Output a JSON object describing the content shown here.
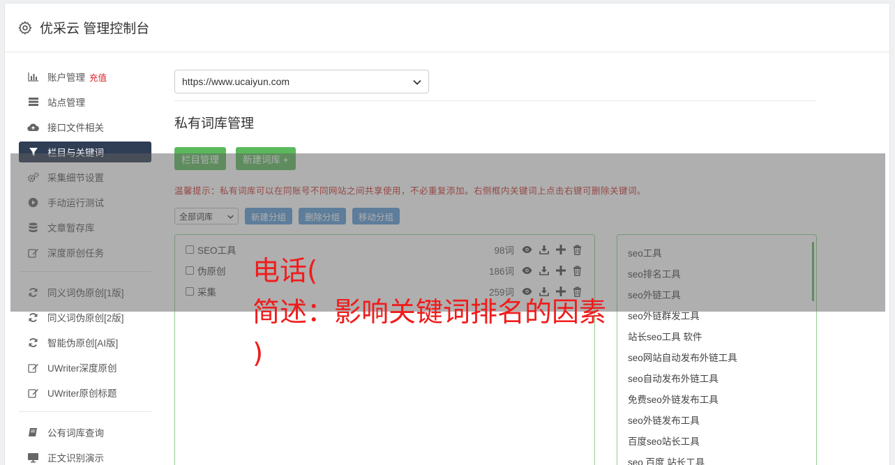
{
  "header": {
    "title": "优采云 管理控制台",
    "icon": "gear-icon"
  },
  "sidebar": {
    "group1": [
      {
        "label": "账户管理",
        "badge": "充值",
        "icon": "bar-chart-icon"
      },
      {
        "label": "站点管理",
        "icon": "server-icon"
      },
      {
        "label": "接口文件相关",
        "icon": "cloud-upload-icon"
      },
      {
        "label": "栏目与关键词",
        "icon": "filter-icon",
        "active": true
      },
      {
        "label": "采集细节设置",
        "icon": "cogs-icon"
      },
      {
        "label": "手动运行测试",
        "icon": "play-circle-icon"
      },
      {
        "label": "文章暂存库",
        "icon": "database-icon"
      },
      {
        "label": "深度原创任务",
        "icon": "edit-icon"
      }
    ],
    "group2": [
      {
        "label": "同义词伪原创[1版]",
        "icon": "refresh-icon"
      },
      {
        "label": "同义词伪原创[2版]",
        "icon": "refresh-icon"
      },
      {
        "label": "智能伪原创[AI版]",
        "icon": "refresh-icon"
      },
      {
        "label": "UWriter深度原创",
        "icon": "edit-icon"
      },
      {
        "label": "UWriter原创标题",
        "icon": "edit-icon"
      }
    ],
    "group3": [
      {
        "label": "公有词库查询",
        "icon": "book-icon"
      },
      {
        "label": "正文识别演示",
        "icon": "desktop-icon"
      }
    ]
  },
  "main": {
    "site_select": "https://www.ucaiyun.com",
    "section_title": "私有词库管理",
    "buttons": {
      "column_manage": "栏目管理",
      "new_library": "新建词库 +"
    },
    "tip": "温馨提示：私有词库可以在同账号不同网站之间共享使用，不必重复添加。右侧框内关键词上点击右键可删除关键词。",
    "toolbar": {
      "filter_select": "全部词库",
      "new_group": "新建分组",
      "delete_group": "删除分组",
      "move_group": "移动分组"
    },
    "libraries": [
      {
        "name": "SEO工具",
        "count": "98词"
      },
      {
        "name": "伪原创",
        "count": "186词"
      },
      {
        "name": "采集",
        "count": "259词"
      }
    ],
    "keywords": [
      "seo工具",
      "seo排名工具",
      "seo外链工具",
      "seo外链群发工具",
      "站长seo工具 软件",
      "seo网站自动发布外链工具",
      "seo自动发布外链工具",
      "免费seo外链发布工具",
      "seo外链发布工具",
      "百度seo站长工具",
      "seo 百度 站长工具"
    ]
  },
  "watermark": {
    "text": "电话(\n简述：影响关键词排名的因素\n)"
  },
  "colors": {
    "accent_green": "#5cb85c",
    "accent_blue": "#5b9bd5",
    "active_nav": "#2f3d55",
    "warning_red": "#c9302c",
    "watermark_red": "#f01c1c"
  }
}
